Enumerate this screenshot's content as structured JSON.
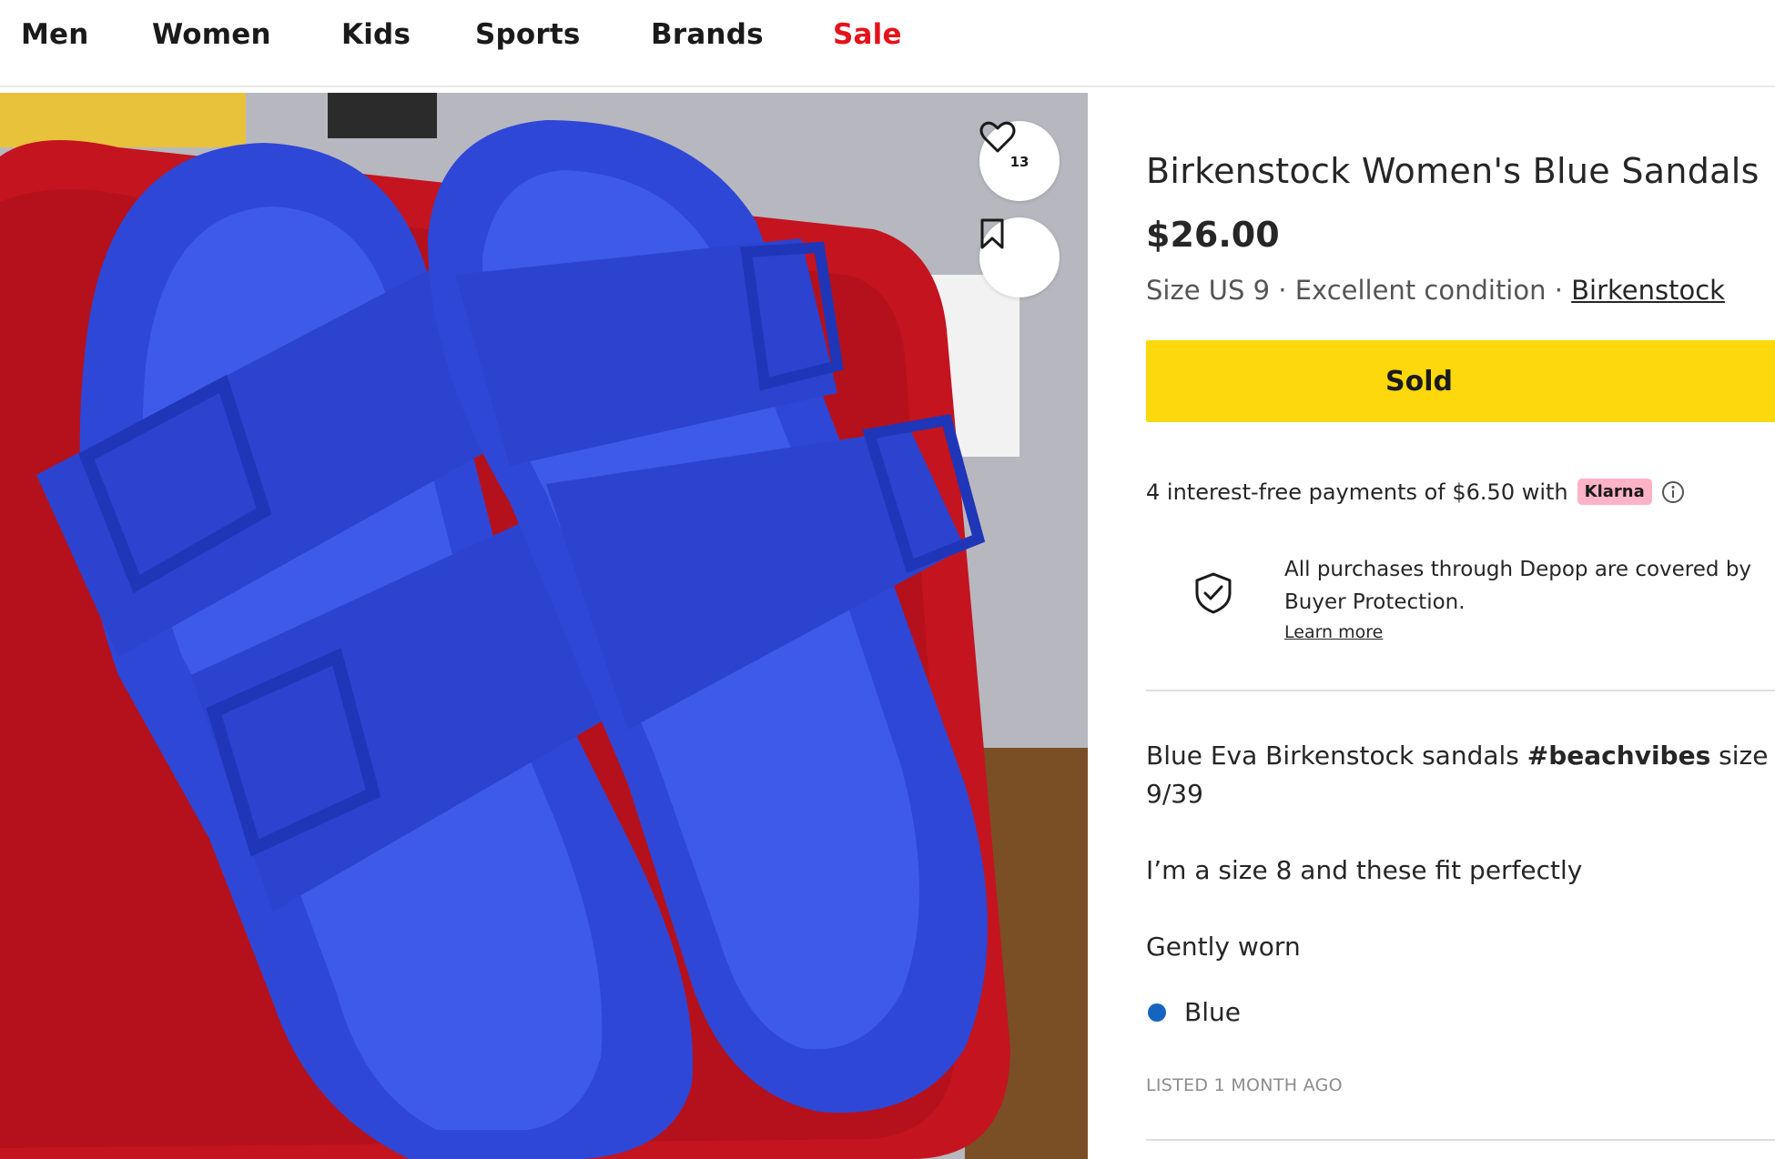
{
  "nav": {
    "items": [
      "Men",
      "Women",
      "Kids",
      "Sports",
      "Brands",
      "Sale"
    ]
  },
  "photo": {
    "like_count": "13",
    "accent_color": "#3a4fd8"
  },
  "product": {
    "title": "Birkenstock Women's Blue Sandals",
    "price": "$26.00",
    "size": "Size US 9",
    "separator": " · ",
    "condition": "Excellent condition",
    "brand": "Birkenstock",
    "status_button": "Sold"
  },
  "payments": {
    "text": "4 interest-free payments of $6.50 with",
    "provider": "Klarna"
  },
  "protection": {
    "line1": "All purchases through Depop are covered by",
    "line2": "Buyer Protection.",
    "link": "Learn more"
  },
  "description": {
    "line1_prefix": "Blue Eva Birkenstock sandals ",
    "hashtag": "#beachvibes",
    "line1_suffix": " size",
    "line2": "9/39",
    "line3": "I’m a size 8 and these fit perfectly",
    "line4": "Gently worn"
  },
  "attributes": {
    "color_name": "Blue",
    "color_hex": "#1565c0"
  },
  "listed": "LISTED 1 MONTH AGO",
  "colors": {
    "sold_button": "#fcd80c",
    "sale_link": "#e4121c",
    "klarna_badge": "#ffb3c7"
  }
}
